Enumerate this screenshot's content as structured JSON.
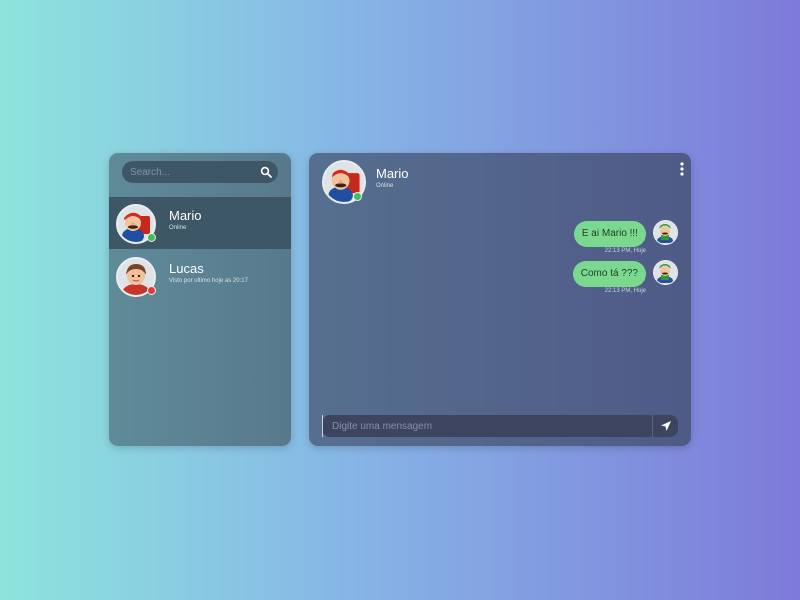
{
  "search": {
    "placeholder": "Search..."
  },
  "contacts": [
    {
      "name": "Mario",
      "status": "Online",
      "status_color": "#3fbf5a",
      "active": true
    },
    {
      "name": "Lucas",
      "status": "Visto por ultimo hoje as 20:17",
      "status_color": "#e23a3a",
      "active": false
    }
  ],
  "chat": {
    "name": "Mario",
    "status": "Online",
    "messages": [
      {
        "text": "E ai Mario !!!",
        "time": "22:13 PM, Hoje"
      },
      {
        "text": "Como tá ???",
        "time": "22:13 PM, Hoje"
      }
    ],
    "composer_placeholder": "Digite uma mensagem"
  },
  "colors": {
    "bubble": "#7ad98f",
    "online": "#3fbf5a",
    "offline": "#e23a3a"
  },
  "icons": [
    "search-icon",
    "menu-dots-icon",
    "send-icon",
    "mario-avatar",
    "lucas-avatar",
    "luigi-avatar"
  ]
}
